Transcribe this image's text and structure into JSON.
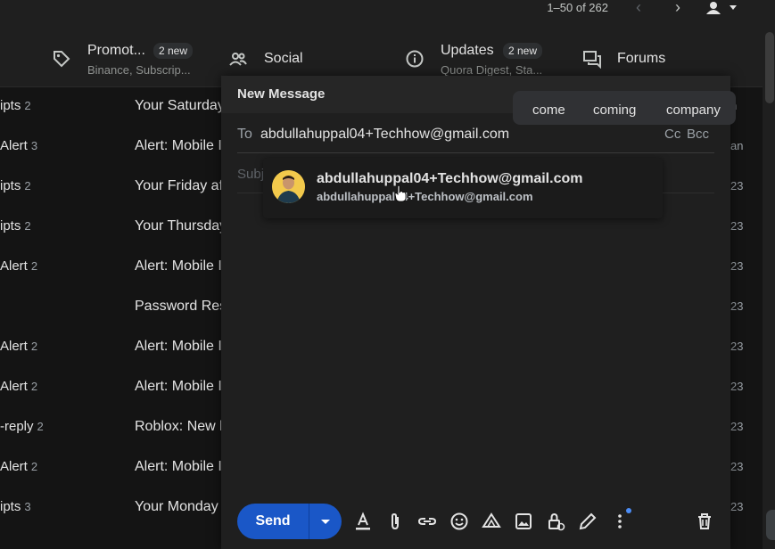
{
  "pager": {
    "range": "1–50 of 262"
  },
  "tabs": {
    "promotions": {
      "title": "Promot...",
      "badge": "2 new",
      "sub": "Binance, Subscrip..."
    },
    "social": {
      "title": "Social"
    },
    "updates": {
      "title": "Updates",
      "badge": "2 new",
      "sub": "Quora Digest, Sta..."
    },
    "forums": {
      "title": "Forums"
    }
  },
  "rows": [
    {
      "sender": "ipts",
      "count": "2",
      "subject": "Your Saturday",
      "date": "n"
    },
    {
      "sender": "Alert",
      "count": "3",
      "subject": "Alert: Mobile I",
      "date": "an"
    },
    {
      "sender": "ipts",
      "count": "2",
      "subject": "Your Friday af",
      "date": "23"
    },
    {
      "sender": "ipts",
      "count": "2",
      "subject": "Your Thursday",
      "date": "23"
    },
    {
      "sender": "Alert",
      "count": "2",
      "subject": "Alert: Mobile I",
      "date": "23"
    },
    {
      "sender": "",
      "count": "",
      "subject": "Password Res",
      "date": "23"
    },
    {
      "sender": "Alert",
      "count": "2",
      "subject": "Alert: Mobile I",
      "date": "23"
    },
    {
      "sender": "Alert",
      "count": "2",
      "subject": "Alert: Mobile I",
      "date": "23"
    },
    {
      "sender": "-reply",
      "count": "2",
      "subject": "Roblox: New lo",
      "date": "23"
    },
    {
      "sender": "Alert",
      "count": "2",
      "subject": "Alert: Mobile I",
      "date": "23"
    },
    {
      "sender": "ipts",
      "count": "3",
      "subject": "Your Monday",
      "date": "23"
    }
  ],
  "compose": {
    "title": "New Message",
    "to_label": "To",
    "to_value": "abdullahuppal04+Techhow@gmail.com",
    "cc": "Cc",
    "bcc": "Bcc",
    "subject_placeholder": "Subject"
  },
  "word_suggestions": [
    "come",
    "coming",
    "company"
  ],
  "contact_suggestion": {
    "name": "abdullahuppal04+Techhow@gmail.com",
    "email": "abdullahuppal04+Techhow@gmail.com"
  },
  "toolbar": {
    "send_label": "Send"
  },
  "colors": {
    "send": "#1a57c7",
    "background": "#1f1f1f",
    "list_bg": "#141414",
    "avatar": "#f2c94c"
  }
}
